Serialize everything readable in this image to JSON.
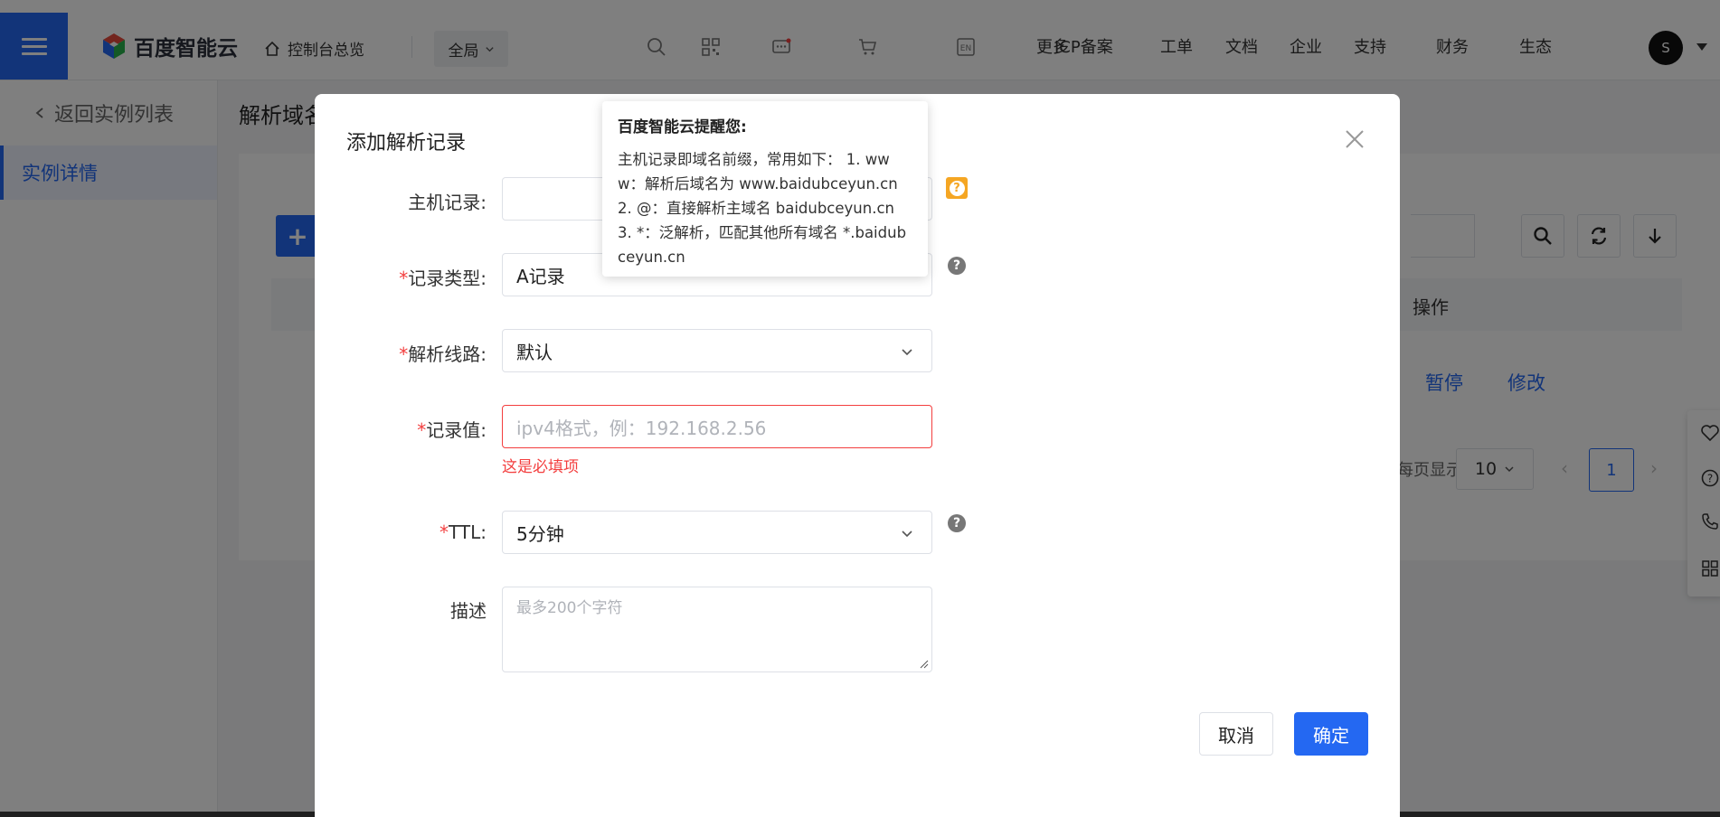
{
  "brand": {
    "logo_text": "百度智能云",
    "accent": "#2468f2",
    "error": "#f33e3e",
    "warning": "#f5a623"
  },
  "navbar": {
    "console_label": "控制台总览",
    "region_label": "全局",
    "links": [
      "更多",
      "ICP备案",
      "工单",
      "文档",
      "企业",
      "支持",
      "财务",
      "生态"
    ],
    "avatar_initial": "S"
  },
  "sidebar": {
    "back_label": "返回实例列表",
    "items": [
      {
        "label": "实例详情"
      }
    ]
  },
  "page": {
    "title": "解析域名"
  },
  "background_table": {
    "op_header": "操作",
    "row_actions": [
      "暂停",
      "修改"
    ],
    "pager": {
      "per_page_label": "每页显示",
      "page_size": "10",
      "current_page": "1"
    }
  },
  "modal": {
    "title": "添加解析记录",
    "fields": {
      "host": {
        "label": "主机记录:",
        "value": ""
      },
      "type": {
        "label": "记录类型:",
        "value": "A记录"
      },
      "line": {
        "label": "解析线路:",
        "value": "默认"
      },
      "value": {
        "label": "记录值:",
        "placeholder": "ipv4格式，例：192.168.2.56",
        "error": "这是必填项"
      },
      "ttl": {
        "label": "TTL:",
        "value": "5分钟"
      },
      "desc": {
        "label": "描述",
        "placeholder": "最多200个字符"
      }
    },
    "buttons": {
      "cancel": "取消",
      "ok": "确定"
    }
  },
  "tooltip": {
    "title": "百度智能云提醒您:",
    "body": "主机记录即域名前缀，常用如下： 1. www：解析后域名为 www.baidubceyun.cn 2. @：直接解析主域名 baidubceyun.cn 3. *：泛解析，匹配其他所有域名 *.baidubceyun.cn"
  }
}
